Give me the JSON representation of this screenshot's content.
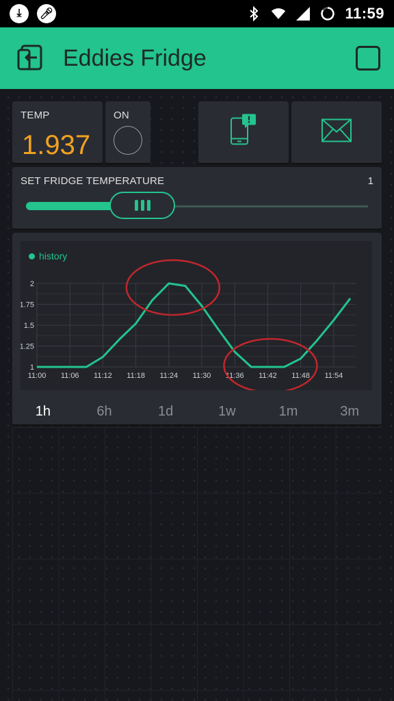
{
  "status_bar": {
    "time": "11:59",
    "icons": [
      "download-icon",
      "mic-icon",
      "bluetooth-icon",
      "wifi-icon",
      "signal-icon",
      "battery-icon"
    ]
  },
  "header": {
    "title": "Eddies Fridge",
    "back_icon": "exit-icon",
    "right_icon": "square-icon"
  },
  "temp_widget": {
    "label": "TEMP",
    "value": "1.937",
    "value_color": "#f0a21f"
  },
  "led_widget": {
    "label": "ON"
  },
  "notify_button": {
    "icon": "phone-notification-icon"
  },
  "email_button": {
    "icon": "envelope-icon"
  },
  "slider": {
    "label": "SET FRIDGE TEMPERATURE",
    "value": "1",
    "position_fraction": 0.32
  },
  "history_chart": {
    "legend": "history",
    "tabs": [
      "1h",
      "6h",
      "1d",
      "1w",
      "1m",
      "3m"
    ],
    "active_tab": "1h"
  },
  "colors": {
    "accent": "#23c48e",
    "background": "#17181d",
    "widget": "#2a2c33",
    "temp": "#f0a21f",
    "annotation": "#c0272d"
  },
  "chart_data": {
    "type": "line",
    "series": [
      {
        "name": "history",
        "x": [
          "11:00",
          "11:01",
          "11:09",
          "11:12",
          "11:15",
          "11:18",
          "11:21",
          "11:24",
          "11:27",
          "11:30",
          "11:33",
          "11:36",
          "11:39",
          "11:42",
          "11:45",
          "11:48",
          "11:51",
          "11:54",
          "11:57"
        ],
        "y": [
          1.0,
          0.98,
          1.0,
          1.12,
          1.33,
          1.52,
          1.8,
          2.0,
          1.97,
          1.73,
          1.45,
          1.18,
          1.0,
          0.98,
          1.0,
          1.1,
          1.32,
          1.56,
          1.82
        ]
      }
    ],
    "x_ticks": [
      "11:00",
      "11:06",
      "11:12",
      "11:18",
      "11:24",
      "11:30",
      "11:36",
      "11:42",
      "11:48",
      "11:54"
    ],
    "y_ticks": [
      "1",
      "1.25",
      "1.5",
      "1.75",
      "2"
    ],
    "ylim": [
      1,
      2
    ],
    "grid": true,
    "legend_position": "top-left",
    "annotations": [
      "circle-around-peak",
      "circle-around-trough"
    ]
  }
}
